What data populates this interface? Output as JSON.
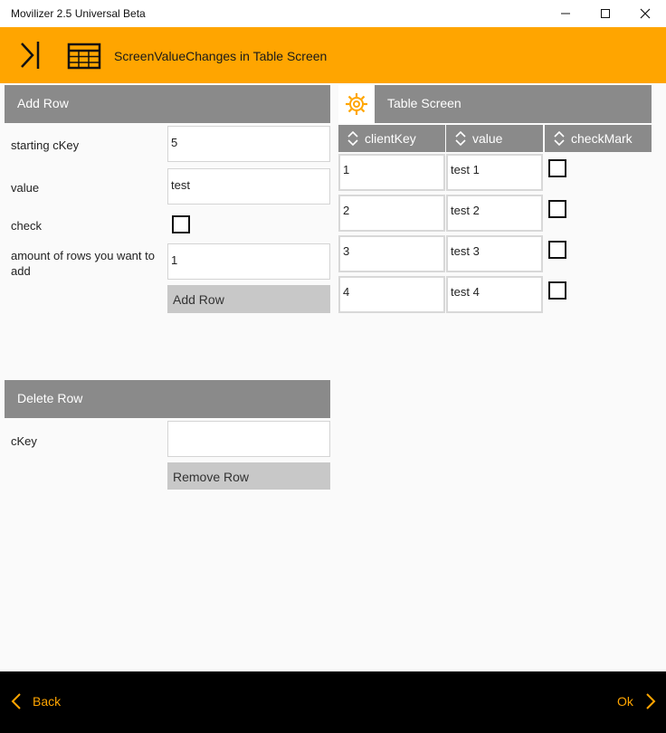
{
  "window": {
    "title": "Movilizer 2.5 Universal Beta"
  },
  "appbar": {
    "screen_title": "ScreenValueChanges in Table Screen"
  },
  "add_row": {
    "header": "Add Row",
    "starting_ckey_label": "starting cKey",
    "starting_ckey_value": "5",
    "value_label": "value",
    "value_value": "test",
    "check_label": "check",
    "amount_label": "amount of rows you want to add",
    "amount_value": "1",
    "button_label": "Add Row"
  },
  "delete_row": {
    "header": "Delete Row",
    "ckey_label": "cKey",
    "ckey_value": "",
    "button_label": "Remove Row"
  },
  "table_screen": {
    "header": "Table Screen",
    "columns": [
      "clientKey",
      "value",
      "checkMark"
    ],
    "rows": [
      {
        "clientKey": "1",
        "value": "test 1",
        "checked": false
      },
      {
        "clientKey": "2",
        "value": "test 2",
        "checked": false
      },
      {
        "clientKey": "3",
        "value": "test 3",
        "checked": false
      },
      {
        "clientKey": "4",
        "value": "test 4",
        "checked": false
      }
    ]
  },
  "footer": {
    "back_label": "Back",
    "ok_label": "Ok"
  },
  "colors": {
    "accent": "#ffa500",
    "header_gray": "#8a8a8a",
    "button_gray": "#c8c8c8",
    "footer": "#000000"
  }
}
